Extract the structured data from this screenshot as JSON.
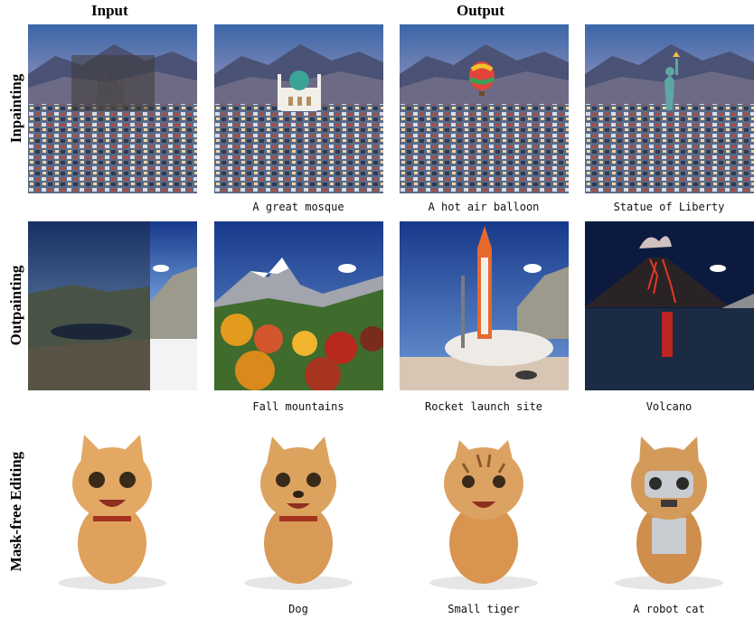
{
  "headers": {
    "input": "Input",
    "output": "Output"
  },
  "rows": [
    {
      "label": "Inpainting",
      "captions": [
        "A great mosque",
        "A hot air balloon",
        "Statue of Liberty"
      ]
    },
    {
      "label": "Outpainting",
      "captions": [
        "Fall mountains",
        "Rocket launch site",
        "Volcano"
      ]
    },
    {
      "label": "Mask-free Editing",
      "captions": [
        "Dog",
        "Small tiger",
        "A robot cat"
      ]
    }
  ]
}
